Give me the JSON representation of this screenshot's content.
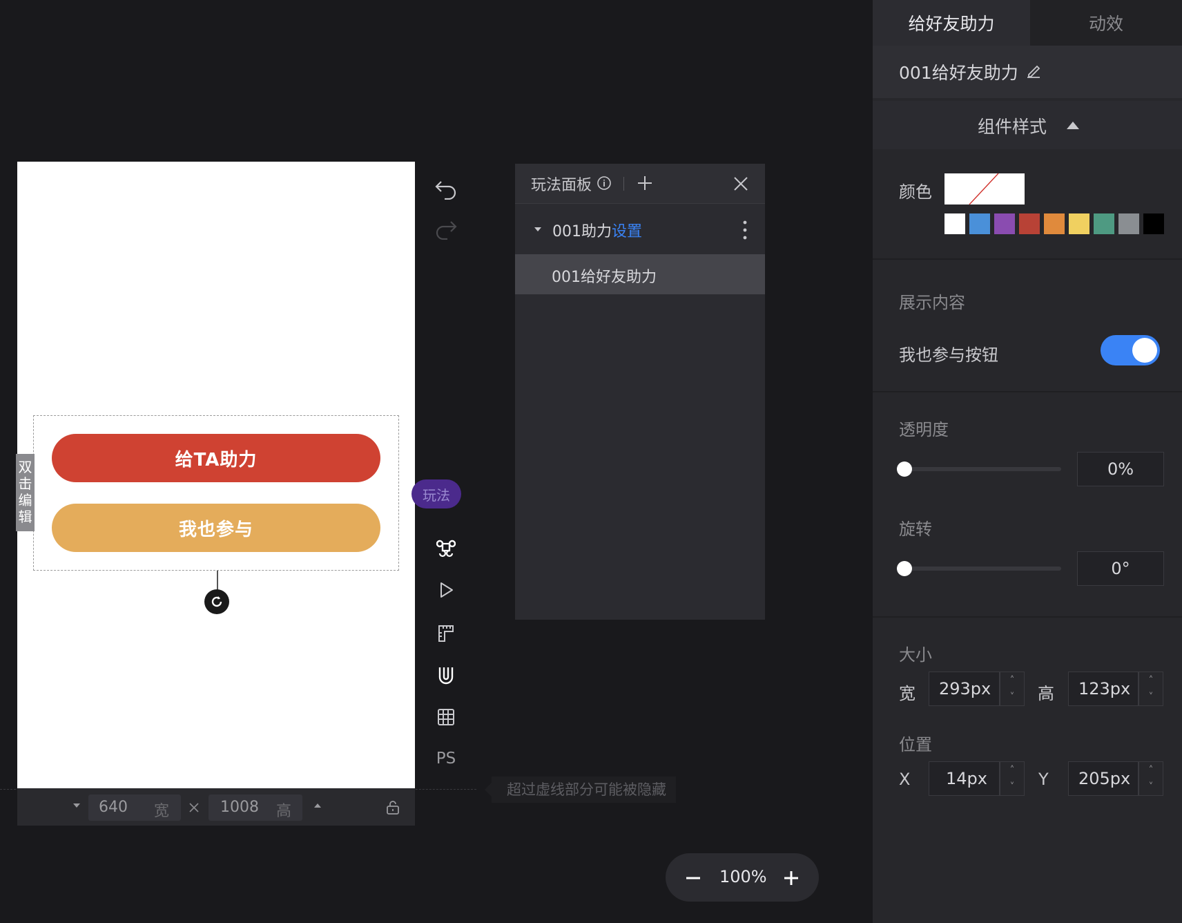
{
  "canvas": {
    "button_help": "给TA助力",
    "button_join": "我也参与",
    "double_click_edit": "双\n击\n编\n辑",
    "width_value": "640",
    "width_unit": "宽",
    "height_value": "1008",
    "height_unit": "高",
    "hidden_hint": "超过虚线部分可能被隐藏"
  },
  "toolbar": {
    "play_tag": "玩法",
    "ps_label": "PS"
  },
  "play_panel": {
    "title": "玩法面板",
    "group_name": "001助力",
    "group_settings": "设置",
    "item_name": "001给好友助力"
  },
  "right_panel": {
    "tab_active": "给好友助力",
    "tab_inactive": "动效",
    "component_name": "001给好友助力",
    "style_section": "组件样式",
    "color_label": "颜色",
    "swatches": [
      "#ffffff",
      "#4a90d9",
      "#8a4cb0",
      "#b84236",
      "#e08a3c",
      "#f0d060",
      "#4e9a82",
      "#8a8e92",
      "#000000"
    ],
    "display_section": "展示内容",
    "join_button_label": "我也参与按钮",
    "join_button_on": true,
    "opacity_label": "透明度",
    "opacity_value": "0%",
    "rotation_label": "旋转",
    "rotation_value": "0°",
    "size_label": "大小",
    "width_label": "宽",
    "width_value": "293px",
    "height_label": "高",
    "height_value": "123px",
    "position_label": "位置",
    "x_label": "X",
    "x_value": "14px",
    "y_label": "Y",
    "y_value": "205px"
  },
  "zoom": {
    "value": "100%"
  },
  "colors": {
    "accent_blue": "#3a83f5",
    "help_button": "#cf4232",
    "join_button": "#e4ac5b",
    "play_tag": "#4b2a8c"
  }
}
